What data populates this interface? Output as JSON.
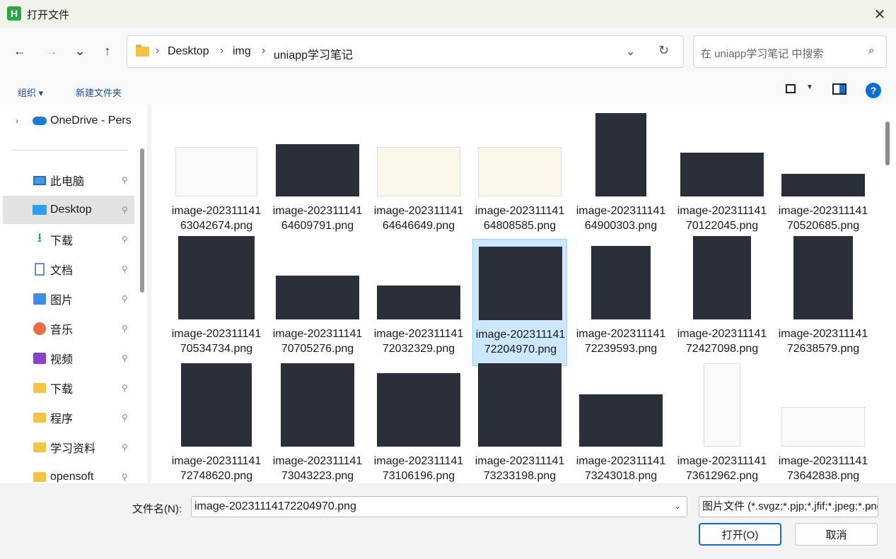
{
  "window": {
    "title": "打开文件",
    "app_icon": "H",
    "close_glyph": "✕"
  },
  "nav": {
    "back": "←",
    "forward": "→",
    "recent": "⌄",
    "up": "↑",
    "breadcrumbs": [
      "Desktop",
      "img",
      "uniapp学习笔记"
    ],
    "separator": "›",
    "dropdown": "⌄",
    "refresh": "↻"
  },
  "search": {
    "placeholder": "在 uniapp学习笔记 中搜索",
    "icon": "⌕"
  },
  "toolbar": {
    "organize": "组织 ▾",
    "new_folder": "新建文件夹",
    "help": "?"
  },
  "sidebar": {
    "items": [
      {
        "label": "OneDrive - Pers",
        "icon": "cloud-icon",
        "pinned": false,
        "expander": "›"
      },
      {
        "label": "此电脑",
        "icon": "monitor-icon",
        "pinned": true
      },
      {
        "label": "Desktop",
        "icon": "desktop-icon",
        "pinned": true,
        "selected": true
      },
      {
        "label": "下载",
        "icon": "download-icon",
        "pinned": true
      },
      {
        "label": "文档",
        "icon": "document-icon",
        "pinned": true
      },
      {
        "label": "图片",
        "icon": "pictures-icon",
        "pinned": true
      },
      {
        "label": "音乐",
        "icon": "music-icon",
        "pinned": true
      },
      {
        "label": "视频",
        "icon": "video-icon",
        "pinned": true
      },
      {
        "label": "下载",
        "icon": "folder-icon",
        "pinned": true
      },
      {
        "label": "程序",
        "icon": "folder-icon",
        "pinned": true
      },
      {
        "label": "学习资料",
        "icon": "folder-icon",
        "pinned": true
      },
      {
        "label": "opensoft",
        "icon": "folder-icon",
        "pinned": true
      }
    ],
    "pin_glyph": "📌"
  },
  "files": [
    {
      "name": "image-20231114163042674.png",
      "style": "light"
    },
    {
      "name": "image-20231114164609791.png",
      "style": "dark"
    },
    {
      "name": "image-20231114164646649.png",
      "style": "cream"
    },
    {
      "name": "image-20231114164808585.png",
      "style": "cream"
    },
    {
      "name": "image-20231114164900303.png",
      "style": "dark"
    },
    {
      "name": "image-20231114170122045.png",
      "style": "dark"
    },
    {
      "name": "image-20231114170520685.png",
      "style": "dark"
    },
    {
      "name": "image-20231114170534734.png",
      "style": "dark"
    },
    {
      "name": "image-20231114170705276.png",
      "style": "dark"
    },
    {
      "name": "image-20231114172032329.png",
      "style": "dark"
    },
    {
      "name": "image-20231114172204970.png",
      "style": "dark",
      "selected": true
    },
    {
      "name": "image-20231114172239593.png",
      "style": "dark"
    },
    {
      "name": "image-20231114172427098.png",
      "style": "dark"
    },
    {
      "name": "image-20231114172638579.png",
      "style": "dark"
    },
    {
      "name": "image-20231114172748620.png",
      "style": "dark"
    },
    {
      "name": "image-20231114173043223.png",
      "style": "dark"
    },
    {
      "name": "image-20231114173106196.png",
      "style": "dark"
    },
    {
      "name": "image-20231114173233198.png",
      "style": "dark"
    },
    {
      "name": "image-20231114173243018.png",
      "style": "dark"
    },
    {
      "name": "image-20231114173612962.png",
      "style": "light"
    },
    {
      "name": "image-20231114173642838.png",
      "style": "light"
    }
  ],
  "footer": {
    "filename_label": "文件名(N):",
    "filename_value": "image-20231114172204970.png",
    "filetype_value": "图片文件 (*.svgz;*.pjp;*.jfif;*.jpeg;*.png)",
    "dropdown": "⌄",
    "open_label": "打开(O)",
    "cancel_label": "取消"
  }
}
